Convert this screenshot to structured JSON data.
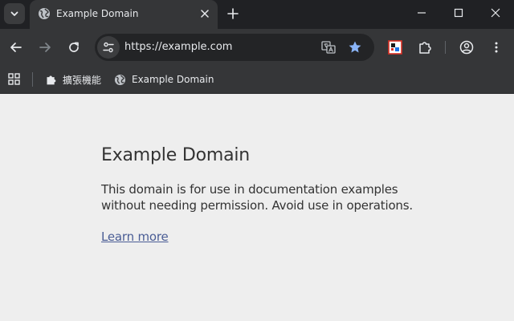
{
  "tab": {
    "title": "Example Domain",
    "favicon": "globe-icon"
  },
  "toolbar": {
    "url": "https://example.com"
  },
  "bookmarks": {
    "items": [
      {
        "label": "擴張機能",
        "icon": "puzzle-icon"
      },
      {
        "label": "Example Domain",
        "icon": "globe-icon"
      }
    ]
  },
  "page": {
    "heading": "Example Domain",
    "line1": "This domain is for use in documentation examples",
    "line2": "without needing permission. Avoid use in operations.",
    "link_label": "Learn more"
  },
  "colors": {
    "titlebar": "#202124",
    "toolbar": "#353638",
    "omnibox": "#232426",
    "page_background": "#eeeeee",
    "text": "#333333",
    "link": "#4a5d95",
    "star": "#8ab4f8"
  }
}
